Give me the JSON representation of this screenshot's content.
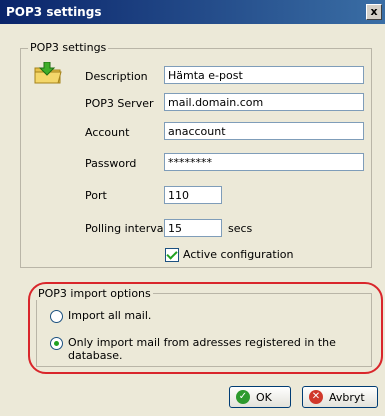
{
  "window": {
    "title": "POP3 settings",
    "close_glyph": "x"
  },
  "settings": {
    "group_title": "POP3 settings",
    "description_label": "Description",
    "description_value": "Hämta e-post",
    "server_label": "POP3 Server",
    "server_value": "mail.domain.com",
    "account_label": "Account",
    "account_value": "anaccount",
    "password_label": "Password",
    "password_value": "********",
    "port_label": "Port",
    "port_value": "110",
    "interval_label": "Polling interval",
    "interval_value": "15",
    "interval_unit": "secs",
    "active_label": "Active configuration",
    "active_checked": true
  },
  "import": {
    "group_title": "POP3 import options",
    "option_all_label": "Import all mail.",
    "option_registered_label": "Only import mail from adresses registered in the database.",
    "selected": "registered"
  },
  "buttons": {
    "ok_label": "OK",
    "cancel_label": "Avbryt"
  },
  "icons": {
    "folder": "folder-download-icon",
    "ok": "ok-check-icon",
    "cancel": "cancel-x-icon"
  },
  "colors": {
    "highlight": "#d9262b",
    "titlebar": "#0a246a"
  }
}
